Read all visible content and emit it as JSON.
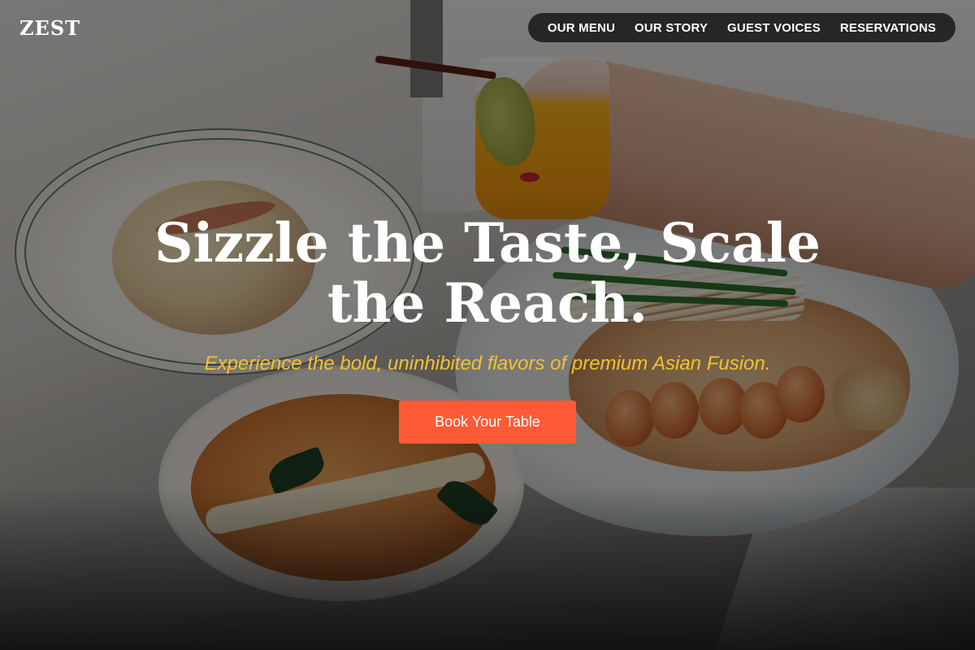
{
  "header": {
    "logo": "ZEST",
    "nav": [
      {
        "label": "OUR MENU"
      },
      {
        "label": "OUR STORY"
      },
      {
        "label": "GUEST VOICES"
      },
      {
        "label": "RESERVATIONS"
      }
    ]
  },
  "hero": {
    "headline": "Sizzle the Taste, Scale the Reach.",
    "subheadline": "Experience the bold, uninhibited flavors of premium Asian Fusion.",
    "cta_label": "Book Your Table",
    "colors": {
      "accent": "#ff5a36",
      "subheadline": "#f2c230"
    }
  }
}
